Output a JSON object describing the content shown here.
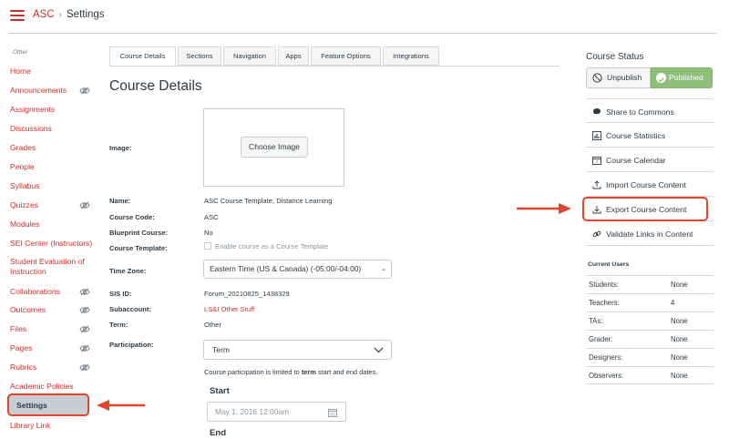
{
  "header": {
    "course_link": "ASC",
    "separator": "›",
    "current": "Settings"
  },
  "nav": {
    "section_title": "Other",
    "items": [
      {
        "label": "Home",
        "hidden": false
      },
      {
        "label": "Announcements",
        "hidden": true
      },
      {
        "label": "Assignments",
        "hidden": false
      },
      {
        "label": "Discussions",
        "hidden": false
      },
      {
        "label": "Grades",
        "hidden": false
      },
      {
        "label": "People",
        "hidden": false
      },
      {
        "label": "Syllabus",
        "hidden": false
      },
      {
        "label": "Quizzes",
        "hidden": true
      },
      {
        "label": "Modules",
        "hidden": false
      },
      {
        "label": "SEI Center (Instructors)",
        "hidden": false
      },
      {
        "label": "Student Evaluation of",
        "label2": "Instruction",
        "hidden": false
      },
      {
        "label": "Collaborations",
        "hidden": true
      },
      {
        "label": "Outcomes",
        "hidden": true
      },
      {
        "label": "Files",
        "hidden": true
      },
      {
        "label": "Pages",
        "hidden": true
      },
      {
        "label": "Rubrics",
        "hidden": true
      },
      {
        "label": "Academic Policies",
        "hidden": false
      },
      {
        "label": "Settings",
        "hidden": false,
        "active": true
      },
      {
        "label": "Library Link",
        "hidden": false
      }
    ]
  },
  "tabs": [
    "Course Details",
    "Sections",
    "Navigation",
    "Apps",
    "Feature Options",
    "Integrations"
  ],
  "main": {
    "title": "Course Details",
    "image_label": "Image:",
    "choose_image": "Choose Image",
    "name_label": "Name:",
    "name_value": "ASC Course Template, Distance Learning",
    "code_label": "Course Code:",
    "code_value": "ASC",
    "blueprint_label": "Blueprint Course:",
    "blueprint_value": "No",
    "template_label": "Course Template:",
    "template_checkbox": "Enable course as a Course Template",
    "timezone_label": "Time Zone:",
    "timezone_value": "Eastern Time (US & Canada) (-05:00/-04:00)",
    "sisid_label": "SIS ID:",
    "sisid_value": "Forum_20210825_1438329",
    "subaccount_label": "Subaccount:",
    "subaccount_value": "LS&I Other Stuff",
    "term_label": "Term:",
    "term_value": "Other",
    "participation_label": "Participation:",
    "participation_value": "Term",
    "participation_note_pre": "Course participation is limited to ",
    "participation_note_bold": "term",
    "participation_note_post": " start and end dates.",
    "start_heading": "Start",
    "start_placeholder": "May 1, 2016 12:00am",
    "end_heading": "End"
  },
  "sidebar": {
    "status_title": "Course Status",
    "unpublish": "Unpublish",
    "published": "Published",
    "actions": [
      {
        "label": "Share to Commons",
        "icon": "commons-icon"
      },
      {
        "label": "Course Statistics",
        "icon": "statistics-icon"
      },
      {
        "label": "Course Calendar",
        "icon": "calendar-icon"
      },
      {
        "label": "Import Course Content",
        "icon": "upload-icon"
      },
      {
        "label": "Export Course Content",
        "icon": "download-icon"
      },
      {
        "label": "Validate Links in Content",
        "icon": "link-icon"
      }
    ],
    "users_title": "Current Users",
    "users": [
      {
        "role": "Students:",
        "count": "None"
      },
      {
        "role": "Teachers:",
        "count": "4"
      },
      {
        "role": "TAs:",
        "count": "None"
      },
      {
        "role": "Grader:",
        "count": "None"
      },
      {
        "role": "Designers:",
        "count": "None"
      },
      {
        "role": "Observers:",
        "count": "None"
      }
    ]
  },
  "colors": {
    "link": "#c9302c",
    "published_green": "#8fc07a",
    "annotation_red": "#e0442a"
  }
}
